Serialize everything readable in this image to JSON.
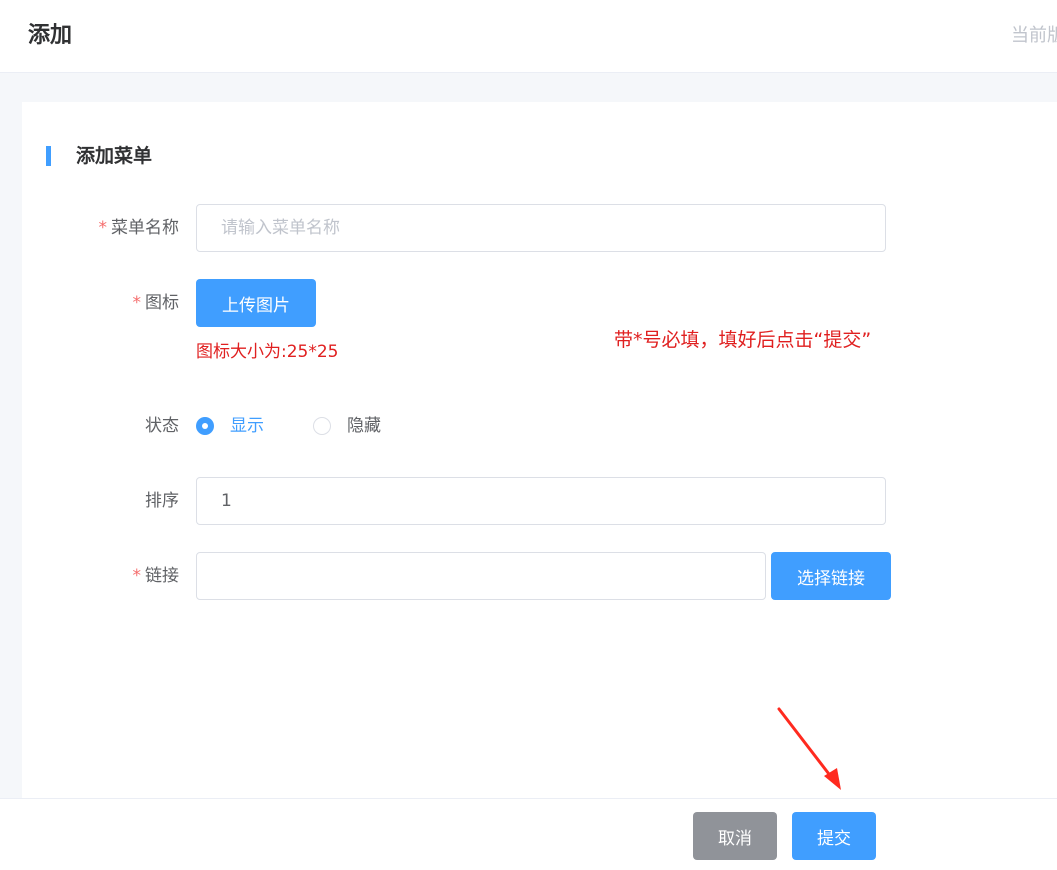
{
  "header": {
    "title": "添加",
    "version_text": "当前版"
  },
  "section": {
    "title": "添加菜单"
  },
  "form": {
    "menu_name": {
      "required_mark": "*",
      "label": "菜单名称",
      "value": "",
      "placeholder": "请输入菜单名称"
    },
    "icon": {
      "required_mark": "*",
      "label": "图标",
      "upload_label": "上传图片",
      "size_hint": "图标大小为:25*25"
    },
    "status": {
      "label": "状态",
      "options": [
        {
          "label": "显示",
          "checked": true
        },
        {
          "label": "隐藏",
          "checked": false
        }
      ]
    },
    "sort": {
      "label": "排序",
      "value": "1"
    },
    "link": {
      "required_mark": "*",
      "label": "链接",
      "value": "",
      "select_label": "选择链接"
    }
  },
  "annotation": {
    "text": "带*号必填，填好后点击“提交”",
    "color": "#e02020"
  },
  "footer": {
    "cancel_label": "取消",
    "submit_label": "提交"
  },
  "colors": {
    "primary": "#409eff",
    "required": "#f56c6c",
    "cancel": "#909399"
  }
}
